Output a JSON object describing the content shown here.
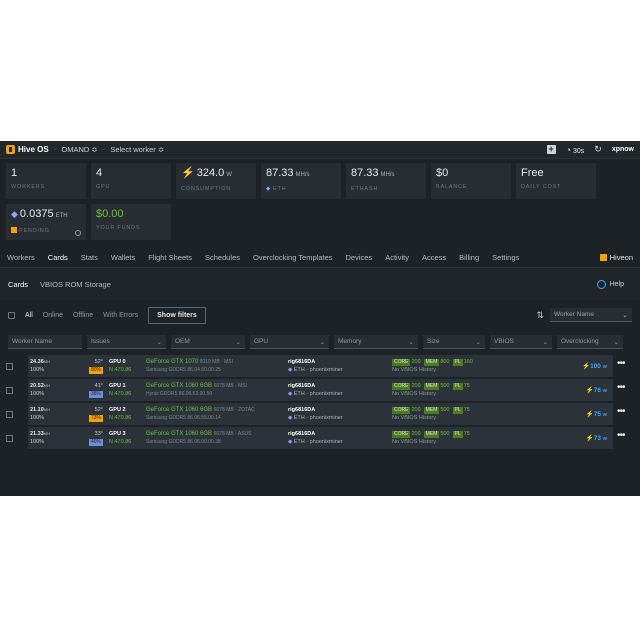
{
  "topbar": {
    "brand": "Hive OS",
    "farm": "OMAND ≎",
    "worker_select": "Select worker ≎",
    "timer": "30s",
    "user": "xpnow"
  },
  "tiles": [
    {
      "value": "1",
      "unit": "",
      "label": "WORKERS"
    },
    {
      "value": "4",
      "unit": "",
      "label": "GPU"
    },
    {
      "value": "324.0",
      "unit": "W",
      "label": "CONSUMPTION"
    },
    {
      "value": "87.33",
      "unit": "MH/s",
      "label": "ETH"
    },
    {
      "value": "87.33",
      "unit": "MH/s",
      "label": "ETHASH"
    },
    {
      "value": "$0",
      "unit": "",
      "label": "BALANCE"
    },
    {
      "value": "Free",
      "unit": "",
      "label": "DAILY COST"
    },
    {
      "value": "0.0375",
      "unit": "ETH",
      "label": "PENDING"
    },
    {
      "value": "$0.00",
      "unit": "",
      "label": "YOUR FUNDS"
    }
  ],
  "mainnav": {
    "tabs": [
      "Workers",
      "Cards",
      "Stats",
      "Wallets",
      "Flight Sheets",
      "Schedules",
      "Overclocking Templates",
      "Devices",
      "Activity",
      "Access",
      "Billing",
      "Settings"
    ],
    "active": "Cards",
    "brand": "Hiveon"
  },
  "subnav": {
    "tabs": [
      "Cards",
      "VBIOS ROM Storage"
    ],
    "help": "Help"
  },
  "filters": {
    "options": [
      "All",
      "Online",
      "Offline",
      "With Errors"
    ],
    "show_filters": "Show filters",
    "sort_by": "Worker Name"
  },
  "column_filters": {
    "worker_name": "Worker Name",
    "issues": "Issues",
    "oem": "OEM",
    "gpu": "GPU",
    "memory": "Memory",
    "size": "Size",
    "vbios": "VBIOS",
    "overclocking": "Overclocking"
  },
  "cards": [
    {
      "hashrate": "24.36",
      "hr_unit": "MH",
      "pct": "100%",
      "temp": "52°",
      "fan": "80%",
      "fan_color": "#f4a300",
      "gpu": "GPU 0",
      "n": "N 470.86",
      "model": "GeForce GTX 1070",
      "spec": "8119 MB · MSI",
      "memory": "Samsung GDDR5 86.04.50.00.25",
      "rig": "rig6816DA",
      "miner": "ETH · phoenixminer",
      "core": "200",
      "mem": "800",
      "pl": "160",
      "vbios": "No VBIOS History",
      "power": "100",
      "power_unit": "W"
    },
    {
      "hashrate": "20.52",
      "hr_unit": "MH",
      "pct": "100%",
      "temp": "41°",
      "fan": "38%",
      "fan_color": "#6b8fd6",
      "gpu": "GPU 1",
      "n": "N 470.86",
      "model": "GeForce GTX 1060 6GB",
      "spec": "6078 MB · MSI",
      "memory": "Hynix GDDR5 86.06.63.00.50",
      "rig": "rig6816DA",
      "miner": "ETH · phoenixminer",
      "core": "200",
      "mem": "500",
      "pl": "75",
      "vbios": "No VBIOS History",
      "power": "76",
      "power_unit": "W"
    },
    {
      "hashrate": "21.10",
      "hr_unit": "MH",
      "pct": "100%",
      "temp": "52°",
      "fan": "73%",
      "fan_color": "#f4a300",
      "gpu": "GPU 2",
      "n": "N 470.86",
      "model": "GeForce GTX 1060 6GB",
      "spec": "6078 MB · ZOTAC",
      "memory": "Samsung GDDR5 86.06.55.00.14",
      "rig": "rig6816DA",
      "miner": "ETH · phoenixminer",
      "core": "200",
      "mem": "500",
      "pl": "75",
      "vbios": "No VBIOS History",
      "power": "75",
      "power_unit": "W"
    },
    {
      "hashrate": "21.33",
      "hr_unit": "MH",
      "pct": "100%",
      "temp": "33°",
      "fan": "40%",
      "fan_color": "#6b8fd6",
      "gpu": "GPU 3",
      "n": "N 470.86",
      "model": "GeForce GTX 1060 6GB",
      "spec": "6078 MB · ASUS",
      "memory": "Samsung GDDR5 86.06.00.00.38",
      "rig": "rig6816DA",
      "miner": "ETH · phoenixminer",
      "core": "200",
      "mem": "500",
      "pl": "75",
      "vbios": "No VBIOS History",
      "power": "73",
      "power_unit": "W"
    }
  ],
  "oc_labels": {
    "core": "CORE",
    "mem": "MEM",
    "pl": "PL"
  }
}
